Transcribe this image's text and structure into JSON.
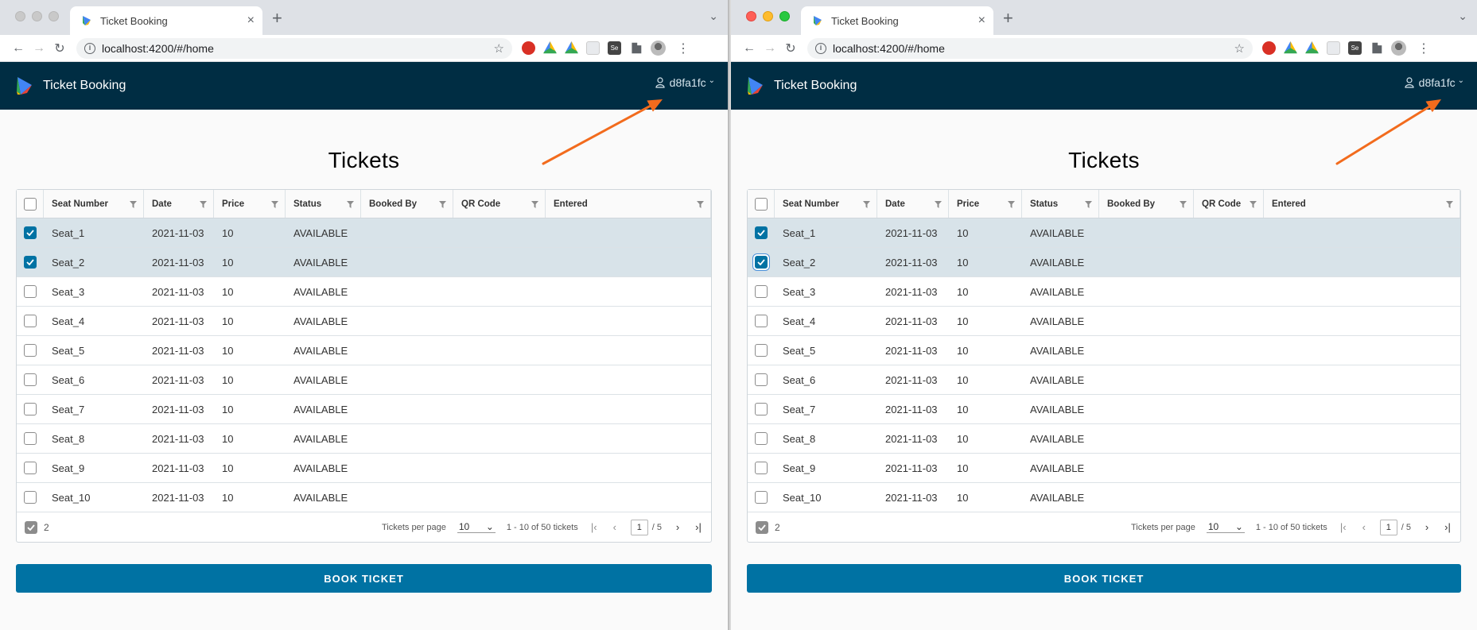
{
  "browser": {
    "tab_title": "Ticket Booking",
    "new_tab": "+",
    "close": "×",
    "url": "localhost:4200/#/home"
  },
  "app": {
    "title": "Ticket Booking",
    "user": "d8fa1fc",
    "accent": "#0072a3",
    "header_bg": "#002d43"
  },
  "page": {
    "title": "Tickets",
    "book_button": "BOOK TICKET"
  },
  "grid": {
    "columns": [
      "Seat Number",
      "Date",
      "Price",
      "Status",
      "Booked By",
      "QR Code",
      "Entered"
    ],
    "rows": [
      {
        "seat": "Seat_1",
        "date": "2021-11-03",
        "price": "10",
        "status": "AVAILABLE",
        "selected": true
      },
      {
        "seat": "Seat_2",
        "date": "2021-11-03",
        "price": "10",
        "status": "AVAILABLE",
        "selected": true
      },
      {
        "seat": "Seat_3",
        "date": "2021-11-03",
        "price": "10",
        "status": "AVAILABLE",
        "selected": false
      },
      {
        "seat": "Seat_4",
        "date": "2021-11-03",
        "price": "10",
        "status": "AVAILABLE",
        "selected": false
      },
      {
        "seat": "Seat_5",
        "date": "2021-11-03",
        "price": "10",
        "status": "AVAILABLE",
        "selected": false
      },
      {
        "seat": "Seat_6",
        "date": "2021-11-03",
        "price": "10",
        "status": "AVAILABLE",
        "selected": false
      },
      {
        "seat": "Seat_7",
        "date": "2021-11-03",
        "price": "10",
        "status": "AVAILABLE",
        "selected": false
      },
      {
        "seat": "Seat_8",
        "date": "2021-11-03",
        "price": "10",
        "status": "AVAILABLE",
        "selected": false
      },
      {
        "seat": "Seat_9",
        "date": "2021-11-03",
        "price": "10",
        "status": "AVAILABLE",
        "selected": false
      },
      {
        "seat": "Seat_10",
        "date": "2021-11-03",
        "price": "10",
        "status": "AVAILABLE",
        "selected": false
      }
    ],
    "footer": {
      "selected_count": "2",
      "per_page_label": "Tickets per page",
      "per_page_value": "10",
      "range_text": "1 - 10 of 50 tickets",
      "current_page": "1",
      "total_pages": "/ 5"
    }
  },
  "annotation_color": "#f26b1d"
}
